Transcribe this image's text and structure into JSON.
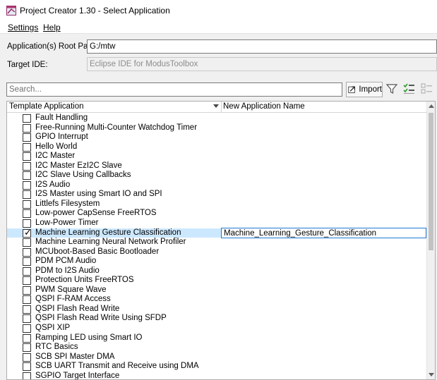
{
  "window": {
    "title": "Project Creator 1.30 - Select Application"
  },
  "menu": {
    "settings": "Settings",
    "help": "Help"
  },
  "form": {
    "root_path_label": "Application(s) Root Path:",
    "root_path_value": "G:/mtw",
    "target_ide_label": "Target IDE:",
    "target_ide_value": "Eclipse IDE for ModusToolbox"
  },
  "search": {
    "placeholder": "Search..."
  },
  "toolbar": {
    "import_label": "Import"
  },
  "table": {
    "col_template": "Template Application",
    "col_new_name": "New Application Name",
    "rows": [
      {
        "label": "Fault Handling",
        "checked": false
      },
      {
        "label": "Free-Running Multi-Counter Watchdog Timer",
        "checked": false
      },
      {
        "label": "GPIO Interrupt",
        "checked": false
      },
      {
        "label": "Hello World",
        "checked": false
      },
      {
        "label": "I2C Master",
        "checked": false
      },
      {
        "label": "I2C Master EzI2C Slave",
        "checked": false
      },
      {
        "label": "I2C Slave Using Callbacks",
        "checked": false
      },
      {
        "label": "I2S Audio",
        "checked": false
      },
      {
        "label": "I2S Master using Smart IO and SPI",
        "checked": false
      },
      {
        "label": "Littlefs Filesystem",
        "checked": false
      },
      {
        "label": "Low-power CapSense FreeRTOS",
        "checked": false
      },
      {
        "label": "Low-Power Timer",
        "checked": false
      },
      {
        "label": "Machine Learning Gesture Classification",
        "checked": true,
        "new_name": "Machine_Learning_Gesture_Classification"
      },
      {
        "label": "Machine Learning Neural Network Profiler",
        "checked": false
      },
      {
        "label": "MCUboot-Based Basic Bootloader",
        "checked": false
      },
      {
        "label": "PDM PCM Audio",
        "checked": false
      },
      {
        "label": "PDM to I2S Audio",
        "checked": false
      },
      {
        "label": "Protection Units FreeRTOS",
        "checked": false
      },
      {
        "label": "PWM Square Wave",
        "checked": false
      },
      {
        "label": "QSPI F-RAM Access",
        "checked": false
      },
      {
        "label": "QSPI Flash Read Write",
        "checked": false
      },
      {
        "label": "QSPI Flash Read Write Using SFDP",
        "checked": false
      },
      {
        "label": "QSPI XIP",
        "checked": false
      },
      {
        "label": "Ramping LED using Smart IO",
        "checked": false
      },
      {
        "label": "RTC Basics",
        "checked": false
      },
      {
        "label": "SCB SPI Master DMA",
        "checked": false
      },
      {
        "label": "SCB UART Transmit and Receive using DMA",
        "checked": false
      },
      {
        "label": "SGPIO Target Interface",
        "checked": false
      }
    ]
  }
}
